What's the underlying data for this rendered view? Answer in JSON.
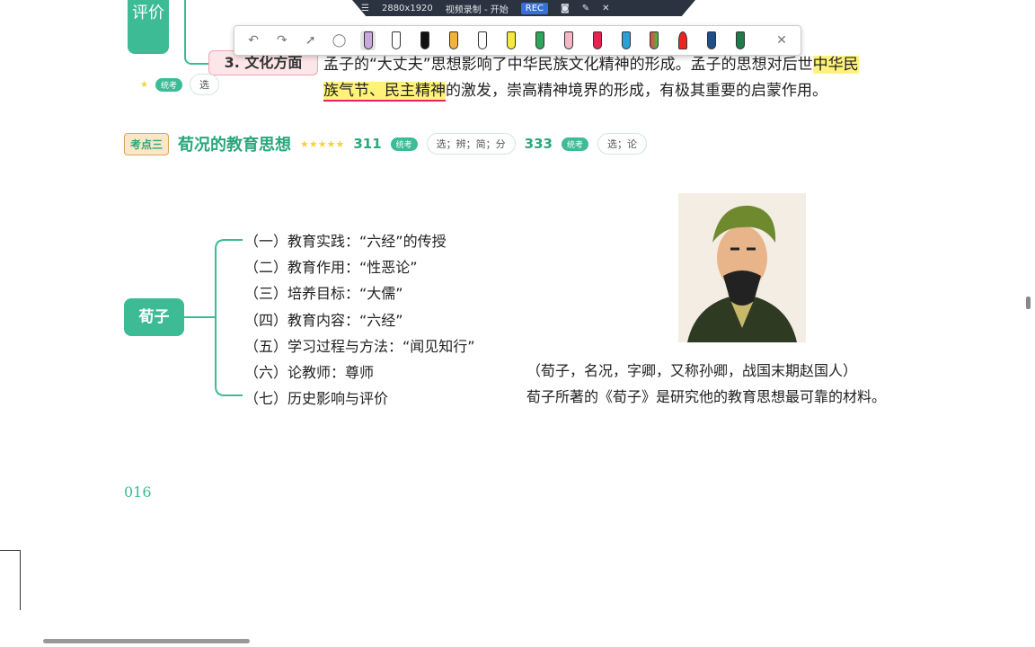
{
  "recorder": {
    "resolution": "2880x1920",
    "title": "视频录制 - 开始",
    "rec": "REC"
  },
  "left_node": "评价",
  "culture": {
    "label": "3. 文化方面",
    "tag_badge": "统考",
    "tag_pill": "选",
    "line1_a": "孟子的“大丈夫”思想影响了中华民族文化精神的形成。孟子的思想对后世",
    "line1_hl": "中华民",
    "line2_hl": "族气节、民主精神",
    "line2_b": "的激发，崇高精神境界的形成，有极其重要的启蒙作用。"
  },
  "kaodian": {
    "icon_label": "考点三",
    "title": "荀况的教育思想",
    "stars": "★★★★★",
    "code1": "311",
    "badge1": "统考",
    "pill1": "选；辨；简；分",
    "code2": "333",
    "badge2": "统考",
    "pill2": "选；论"
  },
  "root": "荀子",
  "items": [
    "（一）教育实践：“六经”的传授",
    "（二）教育作用：“性恶论”",
    "（三）培养目标：“大儒”",
    "（四）教育内容：“六经”",
    "（五）学习过程与方法：“闻见知行”",
    "（六）论教师：尊师",
    "（七）历史影响与评价"
  ],
  "notes": [
    "（荀子，名况，字卿，又称孙卿，战国末期赵国人）",
    "荀子所著的《荀子》是研究他的教育思想最可靠的材料。"
  ],
  "page_number": "016"
}
